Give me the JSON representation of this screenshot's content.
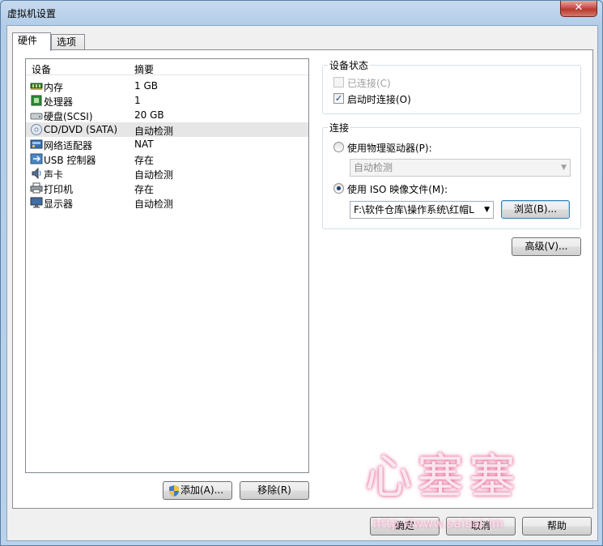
{
  "window": {
    "title": "虚拟机设置",
    "close_glyph": "✕"
  },
  "tabs": [
    {
      "label": "硬件",
      "active": true
    },
    {
      "label": "选项",
      "active": false
    }
  ],
  "device_list": {
    "columns": {
      "device": "设备",
      "summary": "摘要"
    },
    "rows": [
      {
        "name": "内存",
        "summary": "1 GB",
        "icon": "memory-icon",
        "selected": false
      },
      {
        "name": "处理器",
        "summary": "1",
        "icon": "processor-icon",
        "selected": false
      },
      {
        "name": "硬盘(SCSI)",
        "summary": "20 GB",
        "icon": "harddisk-icon",
        "selected": false
      },
      {
        "name": "CD/DVD (SATA)",
        "summary": "自动检测",
        "icon": "cd-dvd-icon",
        "selected": true
      },
      {
        "name": "网络适配器",
        "summary": "NAT",
        "icon": "network-adapter-icon",
        "selected": false
      },
      {
        "name": "USB 控制器",
        "summary": "存在",
        "icon": "usb-icon",
        "selected": false
      },
      {
        "name": "声卡",
        "summary": "自动检测",
        "icon": "sound-card-icon",
        "selected": false
      },
      {
        "name": "打印机",
        "summary": "存在",
        "icon": "printer-icon",
        "selected": false
      },
      {
        "name": "显示器",
        "summary": "自动检测",
        "icon": "display-icon",
        "selected": false
      }
    ]
  },
  "buttons": {
    "add": "添加(A)...",
    "remove": "移除(R)",
    "browse": "浏览(B)...",
    "advanced": "高级(V)...",
    "ok": "确定",
    "cancel": "取消",
    "help": "帮助"
  },
  "device_status": {
    "title": "设备状态",
    "connected": {
      "label": "已连接(C)",
      "checked": false,
      "enabled": false
    },
    "connect_at_power_on": {
      "label": "启动时连接(O)",
      "checked": true,
      "enabled": true
    }
  },
  "connection": {
    "title": "连接",
    "physical_drive": {
      "label": "使用物理驱动器(P):",
      "selected": false,
      "value": "自动检测"
    },
    "iso_image": {
      "label": "使用 ISO 映像文件(M):",
      "selected": true,
      "value": "F:\\软件仓库\\操作系统\\红帽L"
    }
  },
  "watermark": {
    "text": "心塞塞",
    "url": "http://www.saisai.im"
  },
  "colors": {
    "accent": "#3c7fb1",
    "watermark_glow": "#e8719e"
  }
}
